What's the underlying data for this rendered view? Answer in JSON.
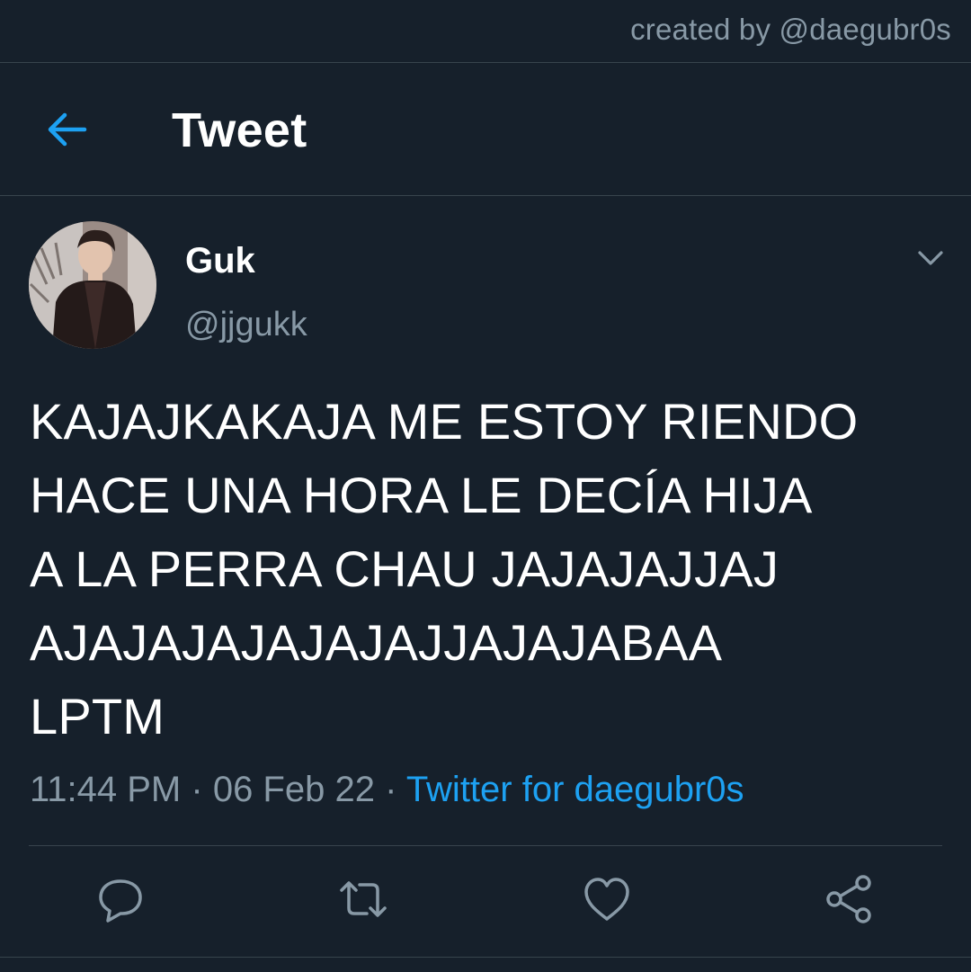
{
  "watermark": "created by @daegubr0s",
  "header": {
    "title": "Tweet",
    "back_icon": "arrow-left-icon"
  },
  "tweet": {
    "author": {
      "name": "Guk",
      "handle": "@jjgukk"
    },
    "text_lines": [
      "KAJAJKAKAJA ME ESTOY RIENDO",
      "HACE UNA HORA LE DECÍA HIJA",
      "A LA PERRA CHAU JAJAJAJJAJ",
      "AJAJAJAJAJAJAJJAJAJABAA",
      "LPTM"
    ],
    "time": "11:44 PM",
    "date": "06 Feb 22",
    "separator": "·",
    "source": "Twitter for daegubr0s"
  },
  "actions": [
    "reply-icon",
    "retweet-icon",
    "like-icon",
    "share-icon"
  ],
  "colors": {
    "background": "#16202b",
    "accent": "#1da1f2",
    "secondary_text": "#8899a6",
    "divider": "#38444d"
  }
}
